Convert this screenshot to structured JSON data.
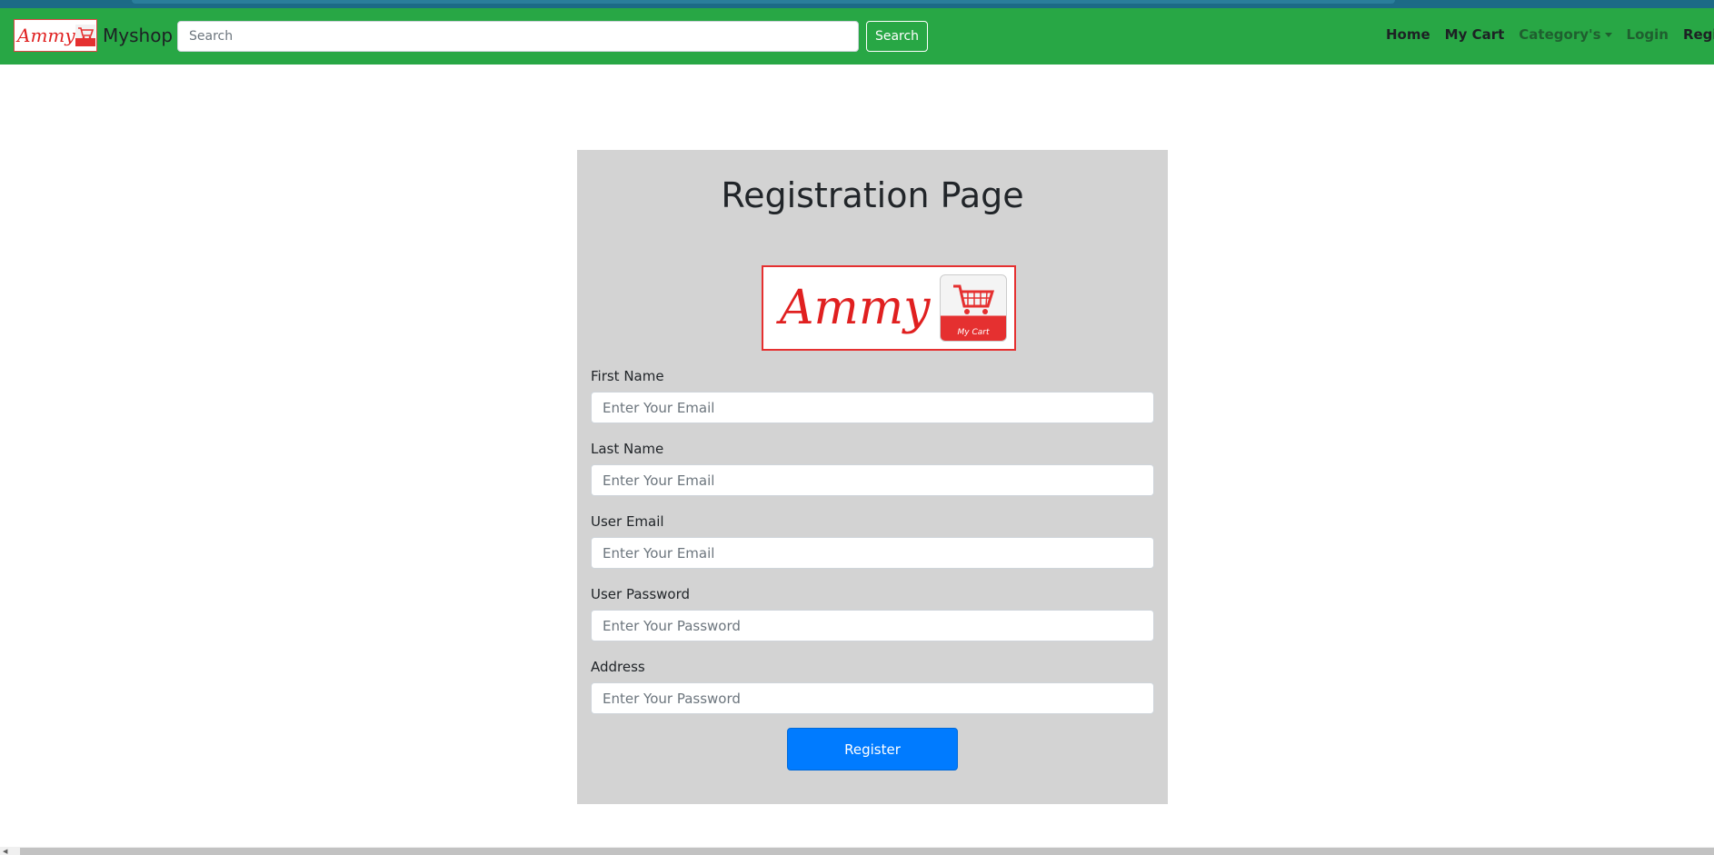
{
  "navbar": {
    "logo_text": "Ammy",
    "brand": "Myshop",
    "search_placeholder": "Search",
    "search_button": "Search",
    "links": [
      "Home",
      "My Cart",
      "Category's",
      "Login",
      "Registration"
    ]
  },
  "form": {
    "title": "Registration Page",
    "logo_text": "Ammy",
    "logo_caption": "My Cart",
    "fields": [
      {
        "label": "First Name",
        "placeholder": "Enter Your Email"
      },
      {
        "label": "Last Name",
        "placeholder": "Enter Your Email"
      },
      {
        "label": "User Email",
        "placeholder": "Enter Your Email"
      },
      {
        "label": "User Password",
        "placeholder": "Enter Your Password"
      },
      {
        "label": "Address",
        "placeholder": "Enter Your Password"
      }
    ],
    "submit": "Register"
  },
  "colors": {
    "navbar": "#28a745",
    "card": "#d3d3d3",
    "primary_button": "#007bff",
    "logo_red": "#e53030"
  },
  "icons": {
    "brand_logo": "cart-logo-icon",
    "hero_logo": "shopping-cart-icon",
    "dropdown": "caret-down-icon"
  }
}
